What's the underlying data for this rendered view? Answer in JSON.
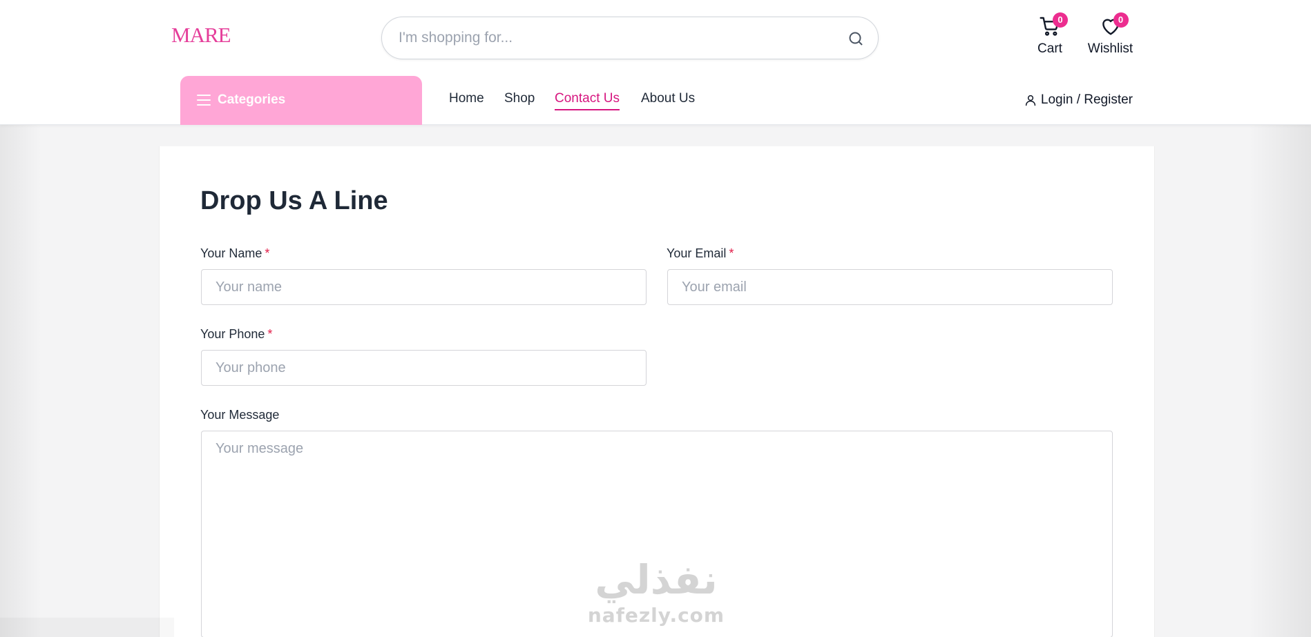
{
  "header": {
    "logo_text": "MARE",
    "search_placeholder": "I'm shopping for...",
    "cart": {
      "label": "Cart",
      "count": "0"
    },
    "wishlist": {
      "label": "Wishlist",
      "count": "0"
    },
    "categories_label": "Categories",
    "nav": [
      {
        "label": "Home"
      },
      {
        "label": "Shop"
      },
      {
        "label": "Contact Us",
        "active": true
      },
      {
        "label": "About Us"
      }
    ],
    "login_label": "Login / Register"
  },
  "form": {
    "title": "Drop Us A Line",
    "required_mark": "*",
    "name": {
      "label": "Your Name",
      "placeholder": "Your name",
      "value": ""
    },
    "email": {
      "label": "Your Email",
      "placeholder": "Your email",
      "value": ""
    },
    "phone": {
      "label": "Your Phone",
      "placeholder": "Your phone",
      "value": ""
    },
    "message": {
      "label": "Your Message",
      "placeholder": "Your message",
      "value": ""
    }
  },
  "watermark": {
    "arabic": "نفذلي",
    "latin": "nafezly.com"
  },
  "colors": {
    "accent": "#d6157f",
    "badge": "#ec2d8f",
    "categories_bg": "#ffa6d6",
    "required": "#e11d48"
  },
  "icons": [
    "search-icon",
    "cart-icon",
    "heart-icon",
    "menu-icon",
    "user-icon"
  ]
}
